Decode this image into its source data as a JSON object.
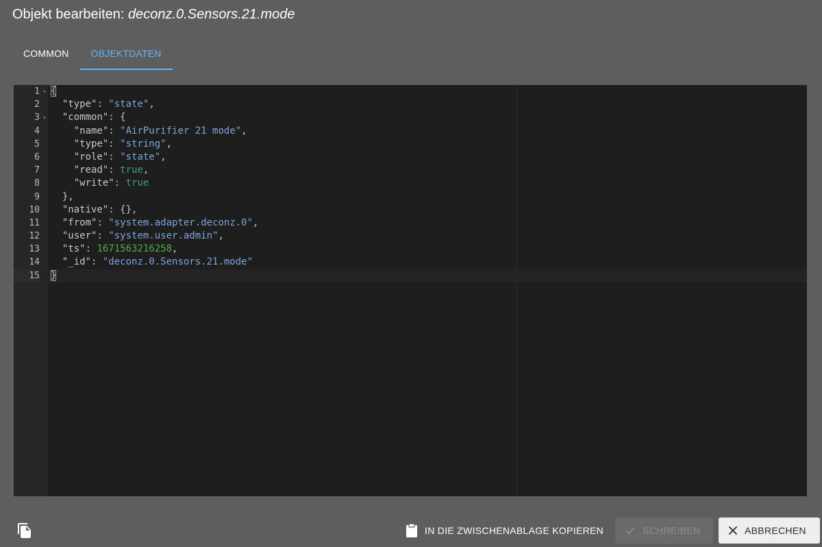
{
  "dialog": {
    "title_prefix": "Objekt bearbeiten:",
    "object_id": "deconz.0.Sensors.21.mode"
  },
  "tabs": [
    {
      "label": "COMMON",
      "active": false
    },
    {
      "label": "OBJEKTDATEN",
      "active": true
    }
  ],
  "editor": {
    "active_line": 15,
    "lines": [
      {
        "n": "1",
        "fold": "▾"
      },
      {
        "n": "2",
        "fold": ""
      },
      {
        "n": "3",
        "fold": "▾"
      },
      {
        "n": "4",
        "fold": ""
      },
      {
        "n": "5",
        "fold": ""
      },
      {
        "n": "6",
        "fold": ""
      },
      {
        "n": "7",
        "fold": ""
      },
      {
        "n": "8",
        "fold": ""
      },
      {
        "n": "9",
        "fold": ""
      },
      {
        "n": "10",
        "fold": ""
      },
      {
        "n": "11",
        "fold": ""
      },
      {
        "n": "12",
        "fold": ""
      },
      {
        "n": "13",
        "fold": ""
      },
      {
        "n": "14",
        "fold": ""
      },
      {
        "n": "15",
        "fold": ""
      }
    ],
    "tokens": {
      "l2_key": "\"type\"",
      "l2_val": "\"state\"",
      "l3_key": "\"common\"",
      "l4_key": "\"name\"",
      "l4_val": "\"AirPurifier 21 mode\"",
      "l5_key": "\"type\"",
      "l5_val": "\"string\"",
      "l6_key": "\"role\"",
      "l6_val": "\"state\"",
      "l7_key": "\"read\"",
      "l7_val": "true",
      "l8_key": "\"write\"",
      "l8_val": "true",
      "l10_key": "\"native\"",
      "l10_val": "{}",
      "l11_key": "\"from\"",
      "l11_val": "\"system.adapter.deconz.0\"",
      "l12_key": "\"user\"",
      "l12_val": "\"system.user.admin\"",
      "l13_key": "\"ts\"",
      "l13_val": "1671563216258",
      "l14_key": "\"_id\"",
      "l14_val": "\"deconz.0.Sensors.21.mode\""
    }
  },
  "footer": {
    "copy_label": "IN DIE ZWISCHENABLAGE KOPIEREN",
    "write_label": "SCHREIBEN",
    "cancel_label": "ABBRECHEN"
  },
  "icons": {
    "left": "file-copy-icon",
    "copy": "clipboard-icon",
    "write": "check-icon",
    "cancel": "close-icon"
  },
  "colors": {
    "accent": "#64b5f6",
    "string": "#7aa6da",
    "number": "#4caf50",
    "boolean": "#3fa06b"
  }
}
